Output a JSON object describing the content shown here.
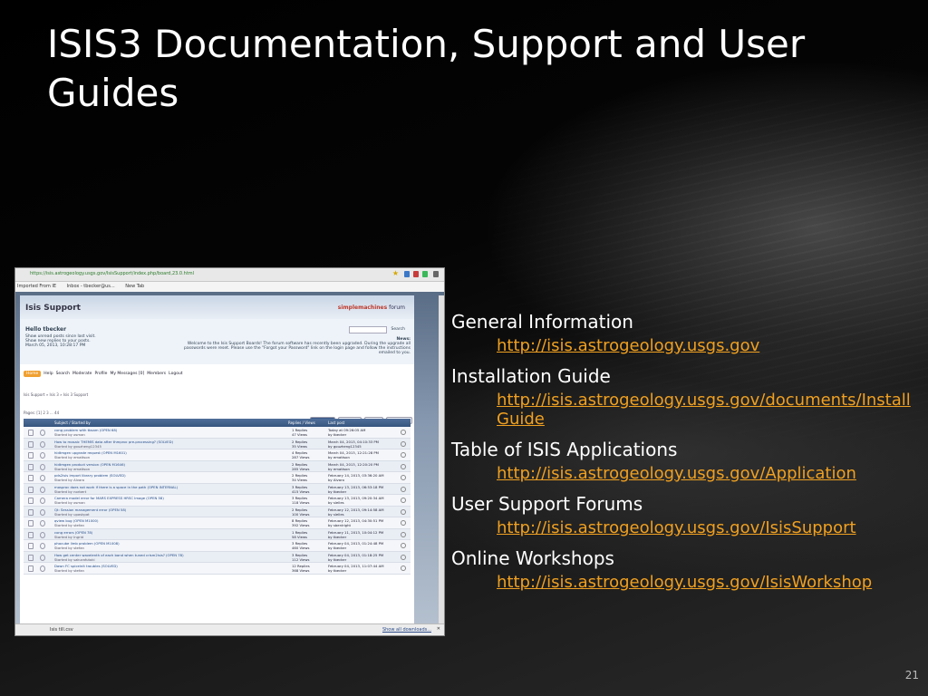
{
  "slide": {
    "title": "ISIS3 Documentation, Support and User Guides",
    "number": "21"
  },
  "screenshot": {
    "url": "https://isis.astrogeology.usgs.gov/IsisSupport/index.php/board,23.0.html",
    "bookmarks": [
      "Imported From IE",
      "Inbox - tbecker@us...",
      "New Tab"
    ],
    "forum_name": "Isis Support",
    "forum_logo_brand": "simplemachines",
    "forum_logo_suffix": "forum",
    "greeting": "Hello tbecker",
    "user_lines": [
      "Show unread posts since last visit.",
      "Show new replies to your posts.",
      "March 05, 2013, 10:28:17 PM"
    ],
    "search_button": "Search",
    "news_label": "News:",
    "news_text": "Welcome to the Isis Support Boards! The forum software has recently been upgraded. During the upgrade all passwords were reset. Please use the \"Forgot your Password\" link on the login page and follow the instructions emailed to you.",
    "menu": [
      "Home",
      "Help",
      "Search",
      "Moderate",
      "Profile",
      "My Messages [0]",
      "Members",
      "Logout"
    ],
    "breadcrumb": "Isis Support » Isis 3 » Isis 3 Support",
    "pages": "Pages: [1] 2 3 ... 44",
    "board_buttons": [
      "NEW TOPIC",
      "NEW POLL",
      "NOTIFY",
      "MARK READ"
    ],
    "table_headers": {
      "subject": "Subject / Started by",
      "replies": "Replies / Views",
      "last_post": "Last post"
    },
    "topics": [
      {
        "subject": "cong problem with tbsam (OPEN 68)",
        "by": "Started by osman",
        "replies": "1 Replies",
        "views": "47 Views",
        "last": "Today at 09:26:05 AM",
        "last_by": "by tbecker"
      },
      {
        "subject": "How to mosaic THEMIS data after thmproc pre-processing? (SOLVED)",
        "by": "Started by gouzheng12345",
        "replies": "2 Replies",
        "views": "35 Views",
        "last": "March 04, 2013, 04:10:33 PM",
        "last_by": "by gouzheng12345"
      },
      {
        "subject": "hidtmgen upgrade request (OPEN M1601)",
        "by": "Started by emattson",
        "replies": "4 Replies",
        "views": "287 Views",
        "last": "March 04, 2013, 12:21:28 PM",
        "last_by": "by emattson"
      },
      {
        "subject": "hidtmgen product version (OPEN M1646)",
        "by": "Started by emattson",
        "replies": "2 Replies",
        "views": "285 Views",
        "last": "March 04, 2013, 12:20:20 PM",
        "last_by": "by emattson"
      },
      {
        "subject": "pds2isis import library problem (SOLVED)",
        "by": "Started by Alvaro",
        "replies": "2 Replies",
        "views": "34 Views",
        "last": "February 14, 2013, 03:36:20 AM",
        "last_by": "by Alvaro"
      },
      {
        "subject": "mosproc does not work if there is a space in the path (OPEN INTERNAL)",
        "by": "Started by norbert",
        "replies": "3 Replies",
        "views": "415 Views",
        "last": "February 13, 2013, 06:53:18 PM",
        "last_by": "by tbecker"
      },
      {
        "subject": "Camera model error for MARS EXPRESS HRSC Image (OPEN 58)",
        "by": "Started by osman",
        "replies": "3 Replies",
        "views": "118 Views",
        "last": "February 13, 2013, 09:20:34 AM",
        "last_by": "by slelles"
      },
      {
        "subject": "Qt: Session management error (OPEN 58)",
        "by": "Started by upaskpat",
        "replies": "2 Replies",
        "views": "100 Views",
        "last": "February 12, 2013, 09:14:58 AM",
        "last_by": "by slelles"
      },
      {
        "subject": "qview bug (OPEN M1000)",
        "by": "Started by stefan",
        "replies": "8 Replies",
        "views": "392 Views",
        "last": "February 12, 2013, 04:30:51 PM",
        "last_by": "by sbenlright"
      },
      {
        "subject": "cong errors (OPEN 78)",
        "by": "Started by Ingrid",
        "replies": "1 Replies",
        "views": "58 Views",
        "last": "February 11, 2013, 10:04:12 PM",
        "last_by": "by tbecker"
      },
      {
        "subject": "phocube limb problem (OPEN M1008)",
        "by": "Started by stefan",
        "replies": "3 Replies",
        "views": "460 Views",
        "last": "February 04, 2013, 01:24:48 PM",
        "last_by": "by tbecker"
      },
      {
        "subject": "How get center wavelenth of each band when tuned crism2isis? (OPEN 78)",
        "by": "Started by sakurafutoki",
        "replies": "3 Replies",
        "views": "112 Views",
        "last": "February 04, 2013, 01:18:25 PM",
        "last_by": "by tbecker"
      },
      {
        "subject": "Dawn FC spiceinit troubles (SOLVED)",
        "by": "Started by stefan",
        "replies": "12 Replies",
        "views": "368 Views",
        "last": "February 04, 2013, 11:07:44 AM",
        "last_by": "by tbecker"
      }
    ],
    "download_file": "Isis till.csv",
    "show_all_downloads": "Show all downloads..."
  },
  "resources": [
    {
      "heading": "General Information",
      "link": "http://isis.astrogeology.usgs.gov"
    },
    {
      "heading": "Installation Guide",
      "link": "http://isis.astrogeology.usgs.gov/documents/InstallGuide"
    },
    {
      "heading": "Table of ISIS Applications",
      "link": "http://isis.astrogeology.usgs.gov/Application"
    },
    {
      "heading": "User Support Forums",
      "link": "http://isis.astrogeology.usgs.gov/IsisSupport"
    },
    {
      "heading": "Online Workshops",
      "link": "http://isis.astrogeology.usgs.gov/IsisWorkshop"
    }
  ],
  "colors": {
    "link": "#f0a020",
    "title_text": "#ffffff",
    "forum_header": "#36557f"
  }
}
